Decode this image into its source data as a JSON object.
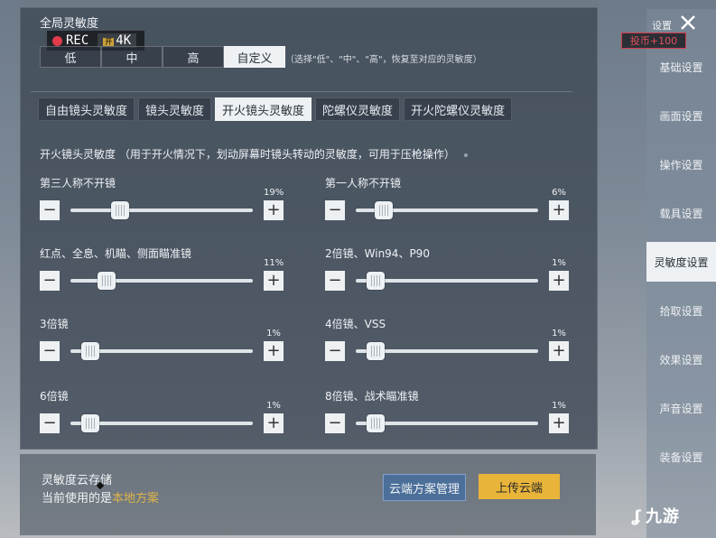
{
  "global": {
    "title": "全局灵敏度"
  },
  "recorder": {
    "rec": "REC",
    "tag": "开",
    "res": "4K"
  },
  "preset": {
    "options": [
      "低",
      "中",
      "高",
      "自定义"
    ],
    "active_index": 3,
    "hint": "（选择\"低\"、\"中\"、\"高\"，恢复至对应的灵敏度）"
  },
  "tabs": [
    "自由镜头灵敏度",
    "镜头灵敏度",
    "开火镜头灵敏度",
    "陀螺仪灵敏度",
    "开火陀螺仪灵敏度"
  ],
  "active_tab": 2,
  "description": "开火镜头灵敏度 （用于开火情况下，划动屏幕时镜头转动的灵敏度，可用于压枪操作）",
  "sliders": [
    {
      "label": "第三人称不开镜",
      "value": "19%",
      "level": 0.19
    },
    {
      "label": "第一人称不开镜",
      "value": "6%",
      "level": 0.06
    },
    {
      "label": "红点、全息、机瞄、侧面瞄准镜",
      "value": "11%",
      "level": 0.11
    },
    {
      "label": "2倍镜、Win94、P90",
      "value": "1%",
      "level": 0.01
    },
    {
      "label": "3倍镜",
      "value": "1%",
      "level": 0.01
    },
    {
      "label": "4倍镜、VSS",
      "value": "1%",
      "level": 0.01
    },
    {
      "label": "6倍镜",
      "value": "1%",
      "level": 0.01
    },
    {
      "label": "8倍镜、战术瞄准镜",
      "value": "1%",
      "level": 0.01
    }
  ],
  "cloud": {
    "title": "灵敏度云存储",
    "current_prefix": "当前使用的是",
    "current_plan": "本地方案",
    "manage_label": "云端方案管理",
    "upload_label": "上传云端"
  },
  "sidebar": {
    "title": "设置",
    "badge": "投币+100",
    "items": [
      "基础设置",
      "画面设置",
      "操作设置",
      "载具设置",
      "灵敏度设置",
      "拾取设置",
      "效果设置",
      "声音设置",
      "装备设置"
    ],
    "active_index": 4
  },
  "watermark": {
    "text": "九游"
  },
  "colors": {
    "accent": "#e8b43a",
    "active_tab_bg": "#eef1f4",
    "plan_text": "#e0b34a"
  }
}
